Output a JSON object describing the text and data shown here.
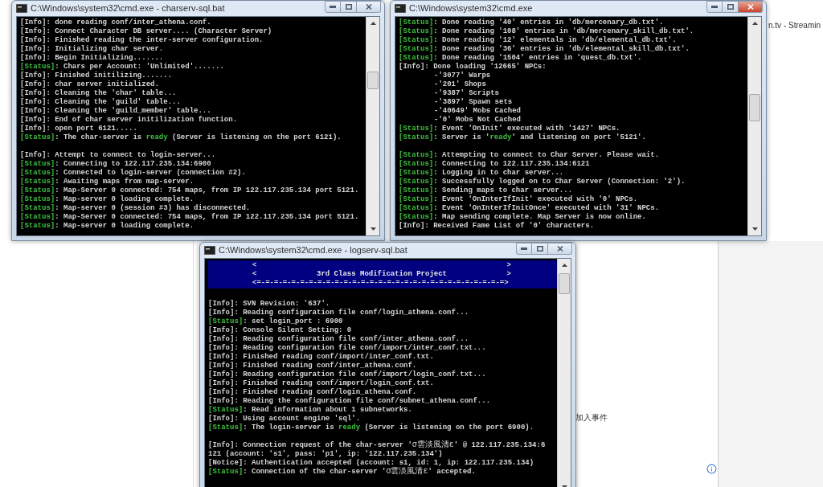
{
  "browser_tab": {
    "label": "n.tv - Streamin"
  },
  "page_link": {
    "label": "加入事件"
  },
  "windows": [
    {
      "title": "C:\\Windows\\system32\\cmd.exe - charserv-sql.bat",
      "active": false,
      "lines": [
        {
          "kind": "info",
          "tag": "[Info]",
          "text": ": done reading conf/inter_athena.conf."
        },
        {
          "kind": "info",
          "tag": "[Info]",
          "text": ": Connect Character DB server.... (Character Server)"
        },
        {
          "kind": "info",
          "tag": "[Info]",
          "text": ": Finished reading the inter-server configuration."
        },
        {
          "kind": "info",
          "tag": "[Info]",
          "text": ": Initializing char server."
        },
        {
          "kind": "info",
          "tag": "[Info]",
          "text": ": Begin Initializing......."
        },
        {
          "kind": "status",
          "tag": "[Status]",
          "text": ": Chars per Account: 'Unlimited'......."
        },
        {
          "kind": "info",
          "tag": "[Info]",
          "text": ": Finished initilizing......."
        },
        {
          "kind": "info",
          "tag": "[Info]",
          "text": ": char server initialized."
        },
        {
          "kind": "info",
          "tag": "[Info]",
          "text": ": Cleaning the 'char' table..."
        },
        {
          "kind": "info",
          "tag": "[Info]",
          "text": ": Cleaning the 'guild' table..."
        },
        {
          "kind": "info",
          "tag": "[Info]",
          "text": ": Cleaning the 'guild_member' table..."
        },
        {
          "kind": "info",
          "tag": "[Info]",
          "text": ": End of char server initilization function."
        },
        {
          "kind": "info",
          "tag": "[Info]",
          "text": ": open port 6121....."
        },
        {
          "kind": "status",
          "tag": "[Status]",
          "parts": [
            {
              "kind": "plain",
              "text": ": The char-server is "
            },
            {
              "kind": "ready",
              "text": "ready"
            },
            {
              "kind": "plain",
              "text": " (Server is listening on the port 6121)."
            }
          ]
        },
        {
          "kind": "blank"
        },
        {
          "kind": "info",
          "tag": "[Info]",
          "text": ": Attempt to connect to login-server..."
        },
        {
          "kind": "status",
          "tag": "[Status]",
          "text": ": Connecting to 122.117.235.134:6900"
        },
        {
          "kind": "status",
          "tag": "[Status]",
          "text": ": Connected to login-server (connection #2)."
        },
        {
          "kind": "status",
          "tag": "[Status]",
          "text": ": Awaiting maps from map-server."
        },
        {
          "kind": "status",
          "tag": "[Status]",
          "text": ": Map-Server 0 connected: 754 maps, from IP 122.117.235.134 port 5121."
        },
        {
          "kind": "status",
          "tag": "[Status]",
          "text": ": Map-server 0 loading complete."
        },
        {
          "kind": "status",
          "tag": "[Status]",
          "text": ": Map-server 0 (session #3) has disconnected."
        },
        {
          "kind": "status",
          "tag": "[Status]",
          "text": ": Map-Server 0 connected: 754 maps, from IP 122.117.235.134 port 5121."
        },
        {
          "kind": "status",
          "tag": "[Status]",
          "text": ": Map-server 0 loading complete."
        }
      ]
    },
    {
      "title": "C:\\Windows\\system32\\cmd.exe",
      "active": true,
      "lines": [
        {
          "kind": "status",
          "tag": "[Status]",
          "text": ": Done reading '40' entries in 'db/mercenary_db.txt'."
        },
        {
          "kind": "status",
          "tag": "[Status]",
          "text": ": Done reading '108' entries in 'db/mercenary_skill_db.txt'."
        },
        {
          "kind": "status",
          "tag": "[Status]",
          "text": ": Done reading '12' elementals in 'db/elemental_db.txt'."
        },
        {
          "kind": "status",
          "tag": "[Status]",
          "text": ": Done reading '36' entries in 'db/elemental_skill_db.txt'."
        },
        {
          "kind": "status",
          "tag": "[Status]",
          "text": ": Done reading '1504' entries in 'quest_db.txt'."
        },
        {
          "kind": "info",
          "tag": "[Info]",
          "text": ": Done loading '12665' NPCs:"
        },
        {
          "kind": "indent",
          "text": "-'3077' Warps"
        },
        {
          "kind": "indent",
          "text": "-'201' Shops"
        },
        {
          "kind": "indent",
          "text": "-'9387' Scripts"
        },
        {
          "kind": "indent",
          "text": "-'3897' Spawn sets"
        },
        {
          "kind": "indent",
          "text": "-'40649' Mobs Cached"
        },
        {
          "kind": "indent",
          "text": "-'0' Mobs Not Cached"
        },
        {
          "kind": "status",
          "tag": "[Status]",
          "text": ": Event 'OnInit' executed with '1427' NPCs."
        },
        {
          "kind": "status",
          "tag": "[Status]",
          "parts": [
            {
              "kind": "plain",
              "text": ": Server is '"
            },
            {
              "kind": "ready",
              "text": "ready"
            },
            {
              "kind": "plain",
              "text": "' and listening on port '5121'."
            }
          ]
        },
        {
          "kind": "blank"
        },
        {
          "kind": "status",
          "tag": "[Status]",
          "text": ": Attempting to connect to Char Server. Please wait."
        },
        {
          "kind": "status",
          "tag": "[Status]",
          "text": ": Connecting to 122.117.235.134:6121"
        },
        {
          "kind": "status",
          "tag": "[Status]",
          "text": ": Logging in to char server..."
        },
        {
          "kind": "status",
          "tag": "[Status]",
          "text": ": Successfully logged on to Char Server (Connection: '2')."
        },
        {
          "kind": "status",
          "tag": "[Status]",
          "text": ": Sending maps to char server..."
        },
        {
          "kind": "status",
          "tag": "[Status]",
          "text": ": Event 'OnInterIfInit' executed with '0' NPCs."
        },
        {
          "kind": "status",
          "tag": "[Status]",
          "text": ": Event 'OnInterIfInitOnce' executed with '31' NPCs."
        },
        {
          "kind": "status",
          "tag": "[Status]",
          "text": ": Map sending complete. Map Server is now online."
        },
        {
          "kind": "info",
          "tag": "[Info]",
          "text": ": Received Fame List of '0' characters."
        }
      ]
    },
    {
      "title": "C:\\Windows\\system32\\cmd.exe - logserv-sql.bat",
      "active": false,
      "banner": {
        "rows": [
          {
            "kind": "edge",
            "left": "<",
            "right": ">"
          },
          {
            "kind": "title",
            "left": "<",
            "title": "3rd Class Modification Project",
            "right": ">"
          },
          {
            "kind": "rule",
            "text": "<=-=-=-=-=-=-=-=-=-=-=-=-=-=-=-=-=-=-=-=-=-=-=-=-=-=-=-=-=>"
          }
        ]
      },
      "lines": [
        {
          "kind": "info",
          "tag": "[Info]",
          "text": ": SVN Revision: '637'."
        },
        {
          "kind": "info",
          "tag": "[Info]",
          "text": ": Reading configuration file conf/login_athena.conf..."
        },
        {
          "kind": "status",
          "tag": "[Status]",
          "text": ": set login_port : 6900"
        },
        {
          "kind": "info",
          "tag": "[Info]",
          "text": ": Console Silent Setting: 0"
        },
        {
          "kind": "info",
          "tag": "[Info]",
          "text": ": Reading configuration file conf/inter_athena.conf..."
        },
        {
          "kind": "info",
          "tag": "[Info]",
          "text": ": Reading configuration file conf/import/inter_conf.txt..."
        },
        {
          "kind": "info",
          "tag": "[Info]",
          "text": ": Finished reading conf/import/inter_conf.txt."
        },
        {
          "kind": "info",
          "tag": "[Info]",
          "text": ": Finished reading conf/inter_athena.conf."
        },
        {
          "kind": "info",
          "tag": "[Info]",
          "text": ": Reading configuration file conf/import/login_conf.txt..."
        },
        {
          "kind": "info",
          "tag": "[Info]",
          "text": ": Finished reading conf/import/login_conf.txt."
        },
        {
          "kind": "info",
          "tag": "[Info]",
          "text": ": Finished reading conf/login_athena.conf."
        },
        {
          "kind": "info",
          "tag": "[Info]",
          "text": ": Reading the configuration file conf/subnet_athena.conf..."
        },
        {
          "kind": "status",
          "tag": "[Status]",
          "text": ": Read information about 1 subnetworks."
        },
        {
          "kind": "info",
          "tag": "[Info]",
          "text": ": Using account engine 'sql'."
        },
        {
          "kind": "status",
          "tag": "[Status]",
          "parts": [
            {
              "kind": "plain",
              "text": ": The login-server is "
            },
            {
              "kind": "ready",
              "text": "ready"
            },
            {
              "kind": "plain",
              "text": " (Server is listening on the port 6900)."
            }
          ]
        },
        {
          "kind": "blank"
        },
        {
          "kind": "info",
          "tag": "[Info]",
          "parts": [
            {
              "kind": "plain",
              "text": ": Connection request of the char-server '"
            },
            {
              "kind": "cjk",
              "text": "σ雲淡風清ε"
            },
            {
              "kind": "plain",
              "text": "' @ 122.117.235.134:6"
            }
          ]
        },
        {
          "kind": "continuation",
          "text": "121 (account: 's1', pass: 'p1', ip: '122.117.235.134')"
        },
        {
          "kind": "notice",
          "tag": "[Notice]",
          "text": ": Authentication accepted (account: s1, id: 1, ip: 122.117.235.134)"
        },
        {
          "kind": "status",
          "tag": "[Status]",
          "parts": [
            {
              "kind": "plain",
              "text": ": Connection of the char-server '"
            },
            {
              "kind": "cjk",
              "text": "σ雲淡風清ε"
            },
            {
              "kind": "plain",
              "text": "' accepted."
            }
          ]
        }
      ]
    }
  ]
}
